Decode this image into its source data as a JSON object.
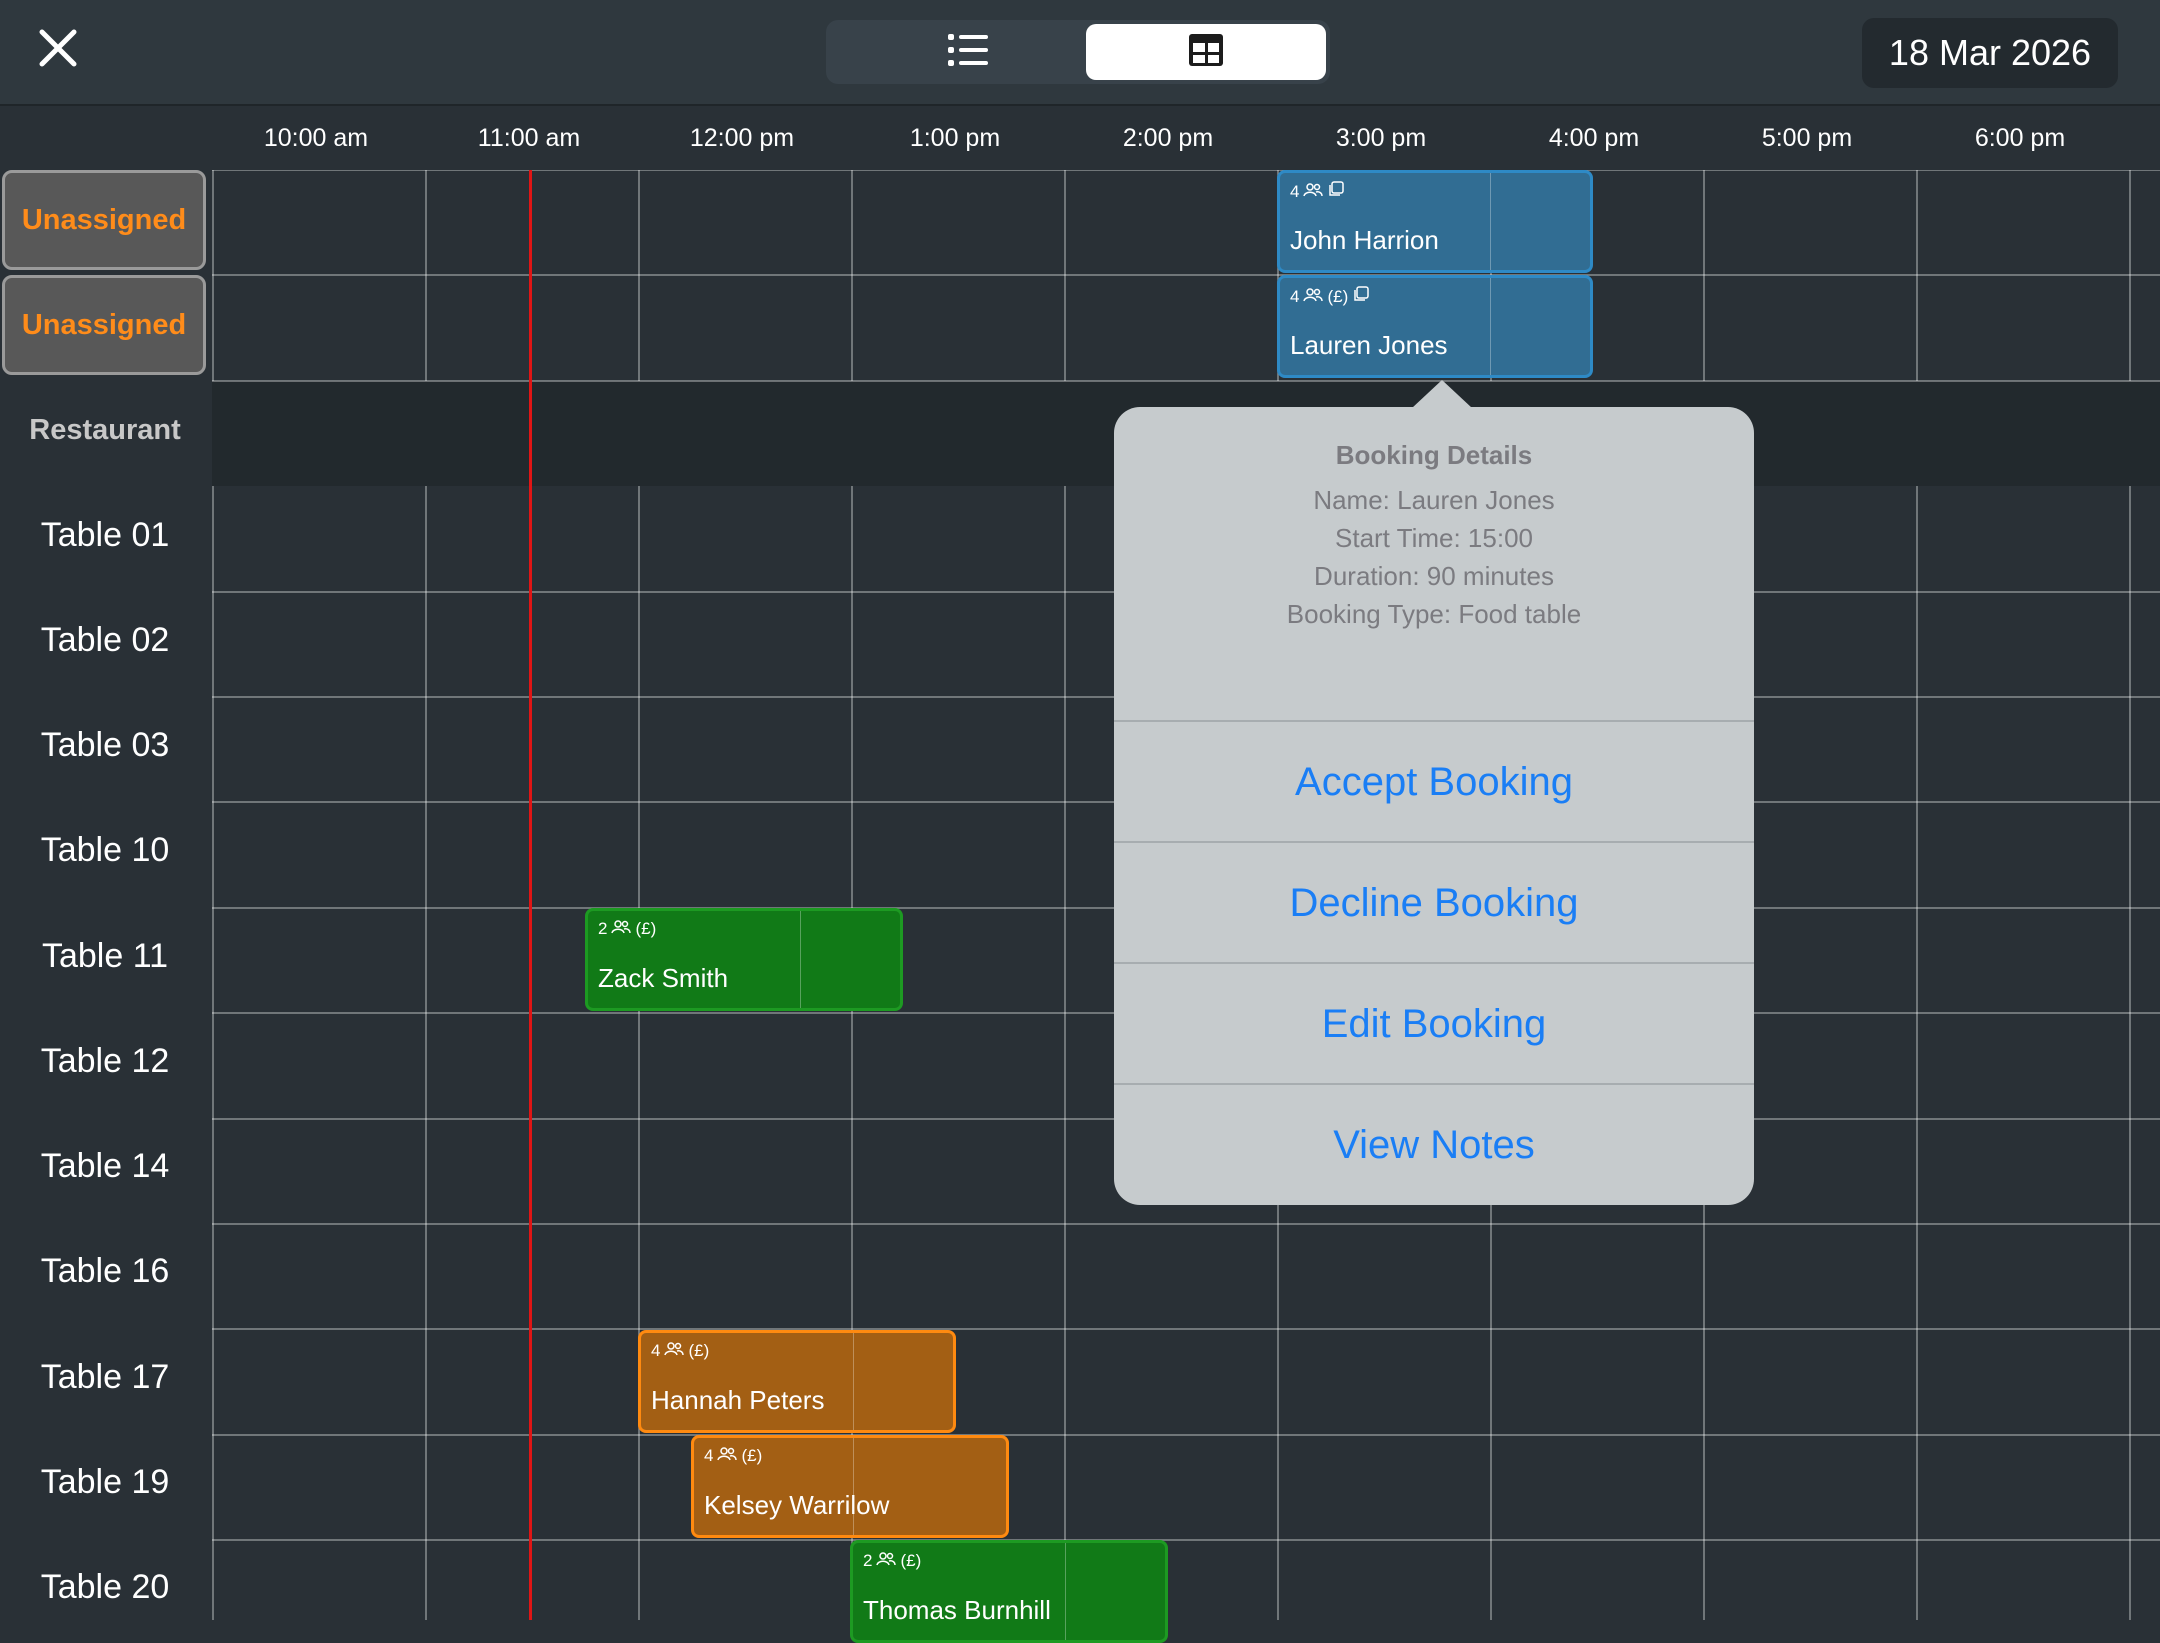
{
  "toolbar": {
    "close_icon": "close-icon",
    "view_toggle": [
      {
        "icon": "list-icon",
        "selected": false
      },
      {
        "icon": "grid-table-icon",
        "selected": true
      }
    ],
    "date": "18 Mar 2026"
  },
  "timeline": {
    "times": [
      "10:00 am",
      "11:00 am",
      "12:00 pm",
      "1:00 pm",
      "2:00 pm",
      "3:00 pm",
      "4:00 pm",
      "5:00 pm",
      "6:00 pm"
    ],
    "current_time_marker": "11:00 am (approx.)"
  },
  "rows": {
    "unassigned": [
      "Unassigned",
      "Unassigned"
    ],
    "section": "Restaurant",
    "tables": [
      "Table 01",
      "Table 02",
      "Table 03",
      "Table 10",
      "Table 11",
      "Table 12",
      "Table 14",
      "Table 16",
      "Table 17",
      "Table 19",
      "Table 20"
    ]
  },
  "bookings": [
    {
      "name": "John Harrion",
      "party": "4",
      "deposit": "",
      "notes_icon": true,
      "color": "#316d93"
    },
    {
      "name": "Lauren Jones",
      "party": "4",
      "deposit": "(£)",
      "notes_icon": true,
      "color": "#316d93"
    },
    {
      "name": "Zack Smith",
      "party": "2",
      "deposit": "(£)",
      "notes_icon": false,
      "color": "#117a17"
    },
    {
      "name": "Hannah Peters",
      "party": "4",
      "deposit": "(£)",
      "notes_icon": false,
      "color": "#a35f14"
    },
    {
      "name": "Kelsey Warrilow",
      "party": "4",
      "deposit": "(£)",
      "notes_icon": false,
      "color": "#a35f14"
    },
    {
      "name": "Thomas Burnhill",
      "party": "2",
      "deposit": "(£)",
      "notes_icon": false,
      "color": "#117a17"
    }
  ],
  "popover": {
    "title": "Booking Details",
    "name_line": "Name: Lauren Jones",
    "start_line": "Start Time: 15:00",
    "duration_line": "Duration: 90 minutes",
    "type_line": "Booking Type: Food table",
    "actions": [
      "Accept Booking",
      "Decline Booking",
      "Edit Booking",
      "View Notes"
    ]
  },
  "colors": {
    "accent": "#1a7ef5",
    "unassigned_text": "#ff8c1a",
    "now_line": "#e01515"
  }
}
